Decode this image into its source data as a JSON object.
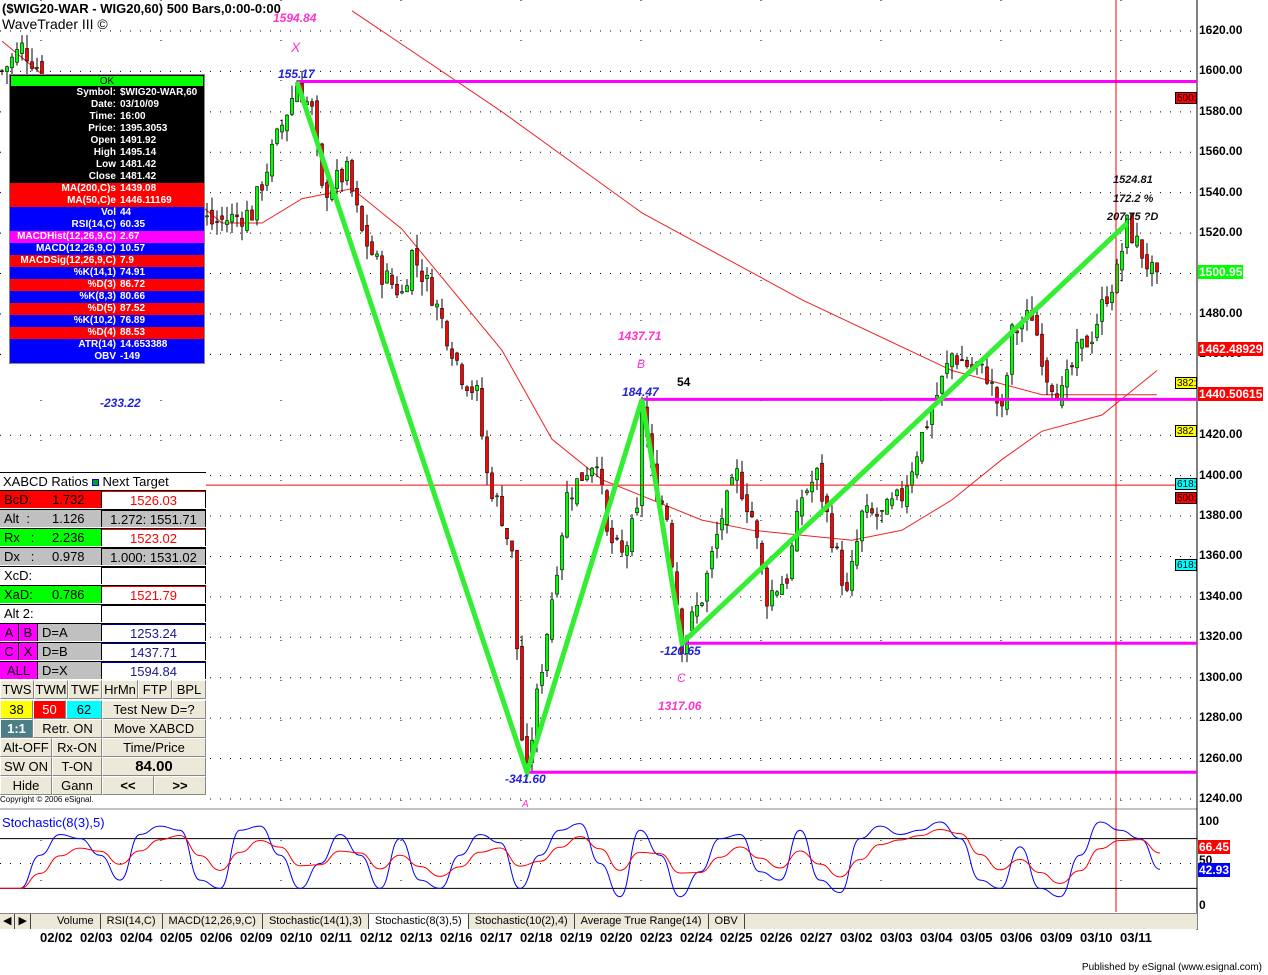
{
  "header": {
    "title": "($WIG20-WAR - WIG20,60) 500 Bars,0:00-0:00",
    "subtitle": "WaveTrader III ©"
  },
  "info_panel": {
    "ok": "OK",
    "rows": [
      {
        "l": "Symbol:",
        "v": "$WIG20-WAR,60",
        "bg": "#000000"
      },
      {
        "l": "Date:",
        "v": "03/10/09",
        "bg": "#000000"
      },
      {
        "l": "Time:",
        "v": "16:00",
        "bg": "#000000"
      },
      {
        "l": "Price:",
        "v": "1395.3053",
        "bg": "#000000"
      },
      {
        "l": "Open",
        "v": "1491.92",
        "bg": "#000000"
      },
      {
        "l": "High",
        "v": "1495.14",
        "bg": "#000000"
      },
      {
        "l": "Low",
        "v": "1481.42",
        "bg": "#000000"
      },
      {
        "l": "Close",
        "v": "1481.42",
        "bg": "#000000"
      },
      {
        "l": "MA(200,C)s",
        "v": "1439.08",
        "bg": "#ff0000"
      },
      {
        "l": "MA(50,C)e",
        "v": "1446.11169",
        "bg": "#ff0000"
      },
      {
        "l": "Vol",
        "v": "44",
        "bg": "#0000ff"
      },
      {
        "l": "RSI(14,C)",
        "v": "60.35",
        "bg": "#0000ff"
      },
      {
        "l": "MACDHist(12,26,9,C)",
        "v": "2.67",
        "bg": "#ff00ff"
      },
      {
        "l": "MACD(12,26,9,C)",
        "v": "10.57",
        "bg": "#0000ff"
      },
      {
        "l": "MACDSig(12,26,9,C)",
        "v": "7.9",
        "bg": "#ff0000"
      },
      {
        "l": "%K(14,1)",
        "v": "74.91",
        "bg": "#0000ff"
      },
      {
        "l": "%D(3)",
        "v": "86.72",
        "bg": "#ff0000"
      },
      {
        "l": "%K(8,3)",
        "v": "80.66",
        "bg": "#0000ff"
      },
      {
        "l": "%D(5)",
        "v": "87.52",
        "bg": "#ff0000"
      },
      {
        "l": "%K(10,2)",
        "v": "76.89",
        "bg": "#0000ff"
      },
      {
        "l": "%D(4)",
        "v": "88.53",
        "bg": "#ff0000"
      },
      {
        "l": "ATR(14)",
        "v": "14.653388",
        "bg": "#0000ff"
      },
      {
        "l": "OBV",
        "v": "-149",
        "bg": "#0000ff"
      }
    ]
  },
  "xabcd": {
    "header": "XABCD Ratios",
    "header2": "Next Target",
    "ratios": [
      {
        "name": "BcD:",
        "val": "1.732",
        "target": "1526.03",
        "bg": "#ff0000",
        "tbg": "#ffffff",
        "tcolor": "#ff0000"
      },
      {
        "name": "Alt  :",
        "val": "1.126",
        "target": "1.272: 1551.71",
        "bg": "#c0c0c0",
        "tbg": "#c0c0c0",
        "tcolor": "#000000"
      },
      {
        "name": "Rx   :",
        "val": "2.236",
        "target": "1523.02",
        "bg": "#00ff00",
        "tbg": "#ffffff",
        "tcolor": "#ff0000"
      },
      {
        "name": "Dx   :",
        "val": "0.978",
        "target": "1.000: 1531.02",
        "bg": "#c0c0c0",
        "tbg": "#c0c0c0",
        "tcolor": "#000000"
      },
      {
        "name": "XcD:",
        "val": "",
        "target": "",
        "bg": "#ffffff",
        "tbg": "#ffffff",
        "tcolor": "#000000"
      },
      {
        "name": "XaD:",
        "val": "0.786",
        "target": "1521.79",
        "bg": "#00ff00",
        "tbg": "#ffffff",
        "tcolor": "#ff0000"
      },
      {
        "name": "Alt 2:",
        "val": "",
        "target": "",
        "bg": "#ffffff",
        "tbg": "#ffffff",
        "tcolor": "#000000"
      }
    ],
    "points": [
      {
        "a": "A",
        "b": "B",
        "eq": "D=A",
        "val": "1253.24"
      },
      {
        "a": "C",
        "b": "X",
        "eq": "D=B",
        "val": "1437.71"
      },
      {
        "a": "ALL",
        "b": "",
        "eq": "D=X",
        "val": "1594.84"
      }
    ],
    "buttons": {
      "tws": "TWS",
      "twm": "TWM",
      "twf": "TWF",
      "hrmn": "HrMn",
      "ftp": "FTP",
      "bpl": "BPL",
      "b38": "38",
      "b50": "50",
      "b62": "62",
      "test": "Test New D=?",
      "ratio": "1:1",
      "retr": "Retr. ON",
      "move": "Move XABCD",
      "alt": "Alt-OFF",
      "rx": "Rx-ON",
      "timeprice": "Time/Price",
      "sw": "SW ON",
      "ton": "T-ON",
      "value": "84.00",
      "hide": "Hide",
      "gann": "Gann",
      "prev": "<<",
      "next": ">>"
    },
    "copyright": "Copyright © 2006 eSignal."
  },
  "annotations": {
    "x_price": "1594.84",
    "x_label": "X",
    "x_move": "155.17",
    "left_move": "-233.22",
    "b_price": "1437.71",
    "b_label": "B",
    "b_move": "184.47",
    "b_bars": "54",
    "c_move": "-120.65",
    "c_label": "C",
    "c_price": "1317.06",
    "a_move": "-341.60",
    "a_label": "A",
    "d_price": "1524.81",
    "d_pct": "172.2 %",
    "d_move": "207.75 ?D"
  },
  "colors": {
    "up": "#00ff00",
    "down": "#ff0000",
    "pattern": "#33ee33",
    "levels": "#ff00ff",
    "ma": "#ee2222",
    "stoch_k": "#0000ff",
    "stoch_d": "#ff0000"
  },
  "chart_data": [
    {
      "type": "candlestick",
      "title": "$WIG20-WAR 60 min",
      "ylim": [
        1230,
        1630
      ],
      "yticks": [
        "1620.00",
        "1600.00",
        "1580.00",
        "1560.00",
        "1540.00",
        "1520.00",
        "1480.00",
        "1460.00",
        "1420.00",
        "1400.00",
        "1380.00",
        "1360.00",
        "1340.00",
        "1320.00",
        "1300.00",
        "1280.00",
        "1260.00",
        "1240.00"
      ],
      "ytick_values": [
        1620,
        1600,
        1580,
        1560,
        1540,
        1520,
        1480,
        1460,
        1420,
        1400,
        1380,
        1360,
        1340,
        1320,
        1300,
        1280,
        1260,
        1240
      ],
      "xticks": [
        "02/02",
        "02/03",
        "02/04",
        "02/05",
        "02/06",
        "02/09",
        "02/10",
        "02/11",
        "02/12",
        "02/13",
        "02/16",
        "02/17",
        "02/18",
        "02/19",
        "02/20",
        "02/23",
        "02/24",
        "02/25",
        "02/26",
        "02/27",
        "03/02",
        "03/03",
        "03/04",
        "03/05",
        "03/06",
        "03/09",
        "03/10",
        "03/11"
      ],
      "price_path_bar_price": [
        [
          0,
          1600
        ],
        [
          4,
          1612
        ],
        [
          8,
          1600
        ],
        [
          20,
          1560
        ],
        [
          42,
          1525
        ],
        [
          50,
          1530
        ],
        [
          54,
          1560
        ],
        [
          59,
          1594
        ],
        [
          62,
          1580
        ],
        [
          64,
          1540
        ],
        [
          69,
          1550
        ],
        [
          72,
          1520
        ],
        [
          76,
          1500
        ],
        [
          80,
          1490
        ],
        [
          82,
          1510
        ],
        [
          86,
          1490
        ],
        [
          89,
          1470
        ],
        [
          92,
          1450
        ],
        [
          95,
          1440
        ],
        [
          97,
          1400
        ],
        [
          100,
          1380
        ],
        [
          102,
          1360
        ],
        [
          104,
          1270
        ],
        [
          105,
          1253
        ],
        [
          107,
          1290
        ],
        [
          110,
          1340
        ],
        [
          113,
          1390
        ],
        [
          116,
          1400
        ],
        [
          119,
          1410
        ],
        [
          121,
          1370
        ],
        [
          124,
          1360
        ],
        [
          127,
          1380
        ],
        [
          128,
          1437
        ],
        [
          130,
          1400
        ],
        [
          133,
          1380
        ],
        [
          136,
          1317
        ],
        [
          140,
          1340
        ],
        [
          144,
          1380
        ],
        [
          147,
          1400
        ],
        [
          150,
          1380
        ],
        [
          153,
          1340
        ],
        [
          157,
          1350
        ],
        [
          160,
          1390
        ],
        [
          163,
          1400
        ],
        [
          166,
          1370
        ],
        [
          169,
          1340
        ],
        [
          172,
          1380
        ],
        [
          176,
          1380
        ],
        [
          180,
          1390
        ],
        [
          184,
          1420
        ],
        [
          187,
          1440
        ],
        [
          190,
          1460
        ],
        [
          193,
          1455
        ],
        [
          197,
          1450
        ],
        [
          200,
          1430
        ],
        [
          202,
          1470
        ],
        [
          206,
          1480
        ],
        [
          209,
          1450
        ],
        [
          212,
          1440
        ],
        [
          215,
          1460
        ],
        [
          218,
          1470
        ],
        [
          221,
          1490
        ],
        [
          223,
          1500
        ],
        [
          225,
          1524
        ],
        [
          228,
          1510
        ],
        [
          231,
          1495
        ]
      ],
      "ma200_bar_price": [
        [
          70,
          1630
        ],
        [
          100,
          1580
        ],
        [
          128,
          1530
        ],
        [
          160,
          1487
        ],
        [
          190,
          1452
        ],
        [
          208,
          1440
        ],
        [
          231,
          1440
        ]
      ],
      "ma50_bar_price": [
        [
          0,
          1615
        ],
        [
          44,
          1525
        ],
        [
          52,
          1525
        ],
        [
          60,
          1537
        ],
        [
          70,
          1542
        ],
        [
          80,
          1522
        ],
        [
          100,
          1462
        ],
        [
          110,
          1418
        ],
        [
          120,
          1398
        ],
        [
          130,
          1388
        ],
        [
          140,
          1378
        ],
        [
          150,
          1373
        ],
        [
          170,
          1368
        ],
        [
          180,
          1373
        ],
        [
          190,
          1388
        ],
        [
          200,
          1408
        ],
        [
          208,
          1422
        ],
        [
          220,
          1430
        ],
        [
          231,
          1452
        ]
      ],
      "pattern": {
        "X": 1594.84,
        "A": 1253.24,
        "B": 1437.71,
        "C": 1317.06,
        "D": 1524.81
      },
      "levels": [
        1595,
        1437.71,
        1317.06,
        1253.24
      ],
      "current_price_line": 1395.3,
      "price_tags": [
        {
          "text": "1500.95",
          "bg": "#00ff00",
          "value": 1500.95
        },
        {
          "text": "1462.48929",
          "bg": "#ff0000",
          "value": 1462.49
        },
        {
          "text": "1440.50615",
          "bg": "#ff0000",
          "value": 1440.5
        }
      ],
      "markers": [
        {
          "text": "500:",
          "bg": "#ff0000",
          "value": 1587
        },
        {
          "text": "382:",
          "bg": "#ffff00",
          "value": 1446
        },
        {
          "text": "382",
          "bg": "#ffff00",
          "value": 1422
        },
        {
          "text": "618:",
          "bg": "#00ffff",
          "value": 1396
        },
        {
          "text": "500:",
          "bg": "#ff0000",
          "value": 1389
        },
        {
          "text": "618:",
          "bg": "#00ffff",
          "value": 1356
        }
      ]
    },
    {
      "type": "line",
      "title": "Stochastic(8(3),5)",
      "ylim": [
        0,
        100
      ],
      "yticks": [
        "100",
        "50",
        "0"
      ],
      "k_values": [
        20,
        20,
        60,
        85,
        80,
        60,
        30,
        85,
        95,
        90,
        30,
        20,
        90,
        95,
        60,
        20,
        50,
        85,
        60,
        20,
        80,
        30,
        20,
        60,
        85,
        75,
        20,
        60,
        90,
        98,
        50,
        10,
        90,
        60,
        10,
        40,
        80,
        85,
        40,
        30,
        90,
        30,
        15,
        80,
        95,
        85,
        90,
        100,
        80,
        30,
        20,
        70,
        20,
        10,
        60,
        100,
        90,
        80,
        42.93
      ],
      "last_k": "42.93",
      "last_d": "66.45",
      "level_lines": [
        80,
        20
      ]
    }
  ],
  "tabs": [
    "Volume",
    "RSI(14,C)",
    "MACD(12,26,9,C)",
    "Stochastic(14(1),3)",
    "Stochastic(8(3),5)",
    "Stochastic(10(2),4)",
    "Average True Range(14)",
    "OBV"
  ],
  "footer": "Published by eSignal (www.esignal.com)"
}
